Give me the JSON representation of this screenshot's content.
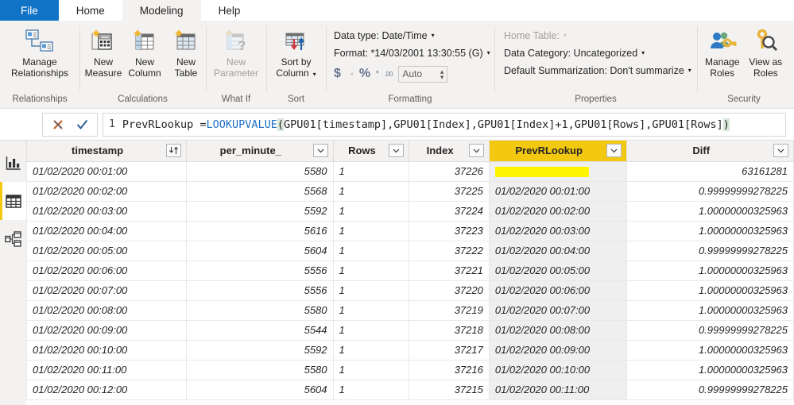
{
  "tabs": [
    {
      "label": "File",
      "state": "file"
    },
    {
      "label": "Home",
      "state": "normal"
    },
    {
      "label": "Modeling",
      "state": "active"
    },
    {
      "label": "Help",
      "state": "normal"
    }
  ],
  "ribbon": {
    "groups": {
      "relationships": {
        "label": "Relationships",
        "buttons": [
          {
            "label": "Manage\nRelationships",
            "icon": "manage-relationships-icon"
          }
        ]
      },
      "calculations": {
        "label": "Calculations",
        "buttons": [
          {
            "label": "New\nMeasure",
            "icon": "new-measure-icon"
          },
          {
            "label": "New\nColumn",
            "icon": "new-column-icon"
          },
          {
            "label": "New\nTable",
            "icon": "new-table-icon"
          }
        ]
      },
      "whatif": {
        "label": "What If",
        "buttons": [
          {
            "label": "New\nParameter",
            "icon": "new-parameter-icon",
            "disabled": true
          }
        ]
      },
      "sort": {
        "label": "Sort",
        "buttons": [
          {
            "label": "Sort by\nColumn",
            "icon": "sort-by-column-icon",
            "caret": true
          }
        ]
      },
      "formatting": {
        "label": "Formatting",
        "data_type": "Data type: Date/Time",
        "format": "Format: *14/03/2001 13:30:55 (G)",
        "currency_symbol": "$",
        "percent_symbol": "%",
        "comma_symbol": "'",
        "decimal_symbol": ".00",
        "decimal_places_value": "Auto"
      },
      "properties": {
        "label": "Properties",
        "home_table": "Home Table:",
        "data_category": "Data Category: Uncategorized",
        "default_summarization": "Default Summarization: Don't summarize"
      },
      "security": {
        "label": "Security",
        "buttons": [
          {
            "label": "Manage\nRoles",
            "icon": "manage-roles-icon"
          },
          {
            "label": "View as\nRoles",
            "icon": "view-as-roles-icon"
          }
        ]
      }
    }
  },
  "formula_bar": {
    "line_number": "1",
    "cancel_icon": "cancel-x-icon",
    "accept_icon": "accept-check-icon",
    "prefix": "PrevRLookup = ",
    "function_name": "LOOKUPVALUE",
    "open_paren": "(",
    "args": "GPU01[timestamp],GPU01[Index],GPU01[Index]+1,GPU01[Rows],GPU01[Rows]",
    "close_paren": ")",
    "full_formula": "PrevRLookup = LOOKUPVALUE(GPU01[timestamp],GPU01[Index],GPU01[Index]+1,GPU01[Rows],GPU01[Rows])"
  },
  "sidebar": {
    "items": [
      {
        "name": "report-view",
        "icon": "bar-chart-icon",
        "selected": false
      },
      {
        "name": "data-view",
        "icon": "table-grid-icon",
        "selected": true
      },
      {
        "name": "model-view",
        "icon": "model-relationships-icon",
        "selected": false
      }
    ]
  },
  "grid": {
    "columns": [
      {
        "label": "timestamp",
        "sorted": true,
        "highlighted": false,
        "align": "center"
      },
      {
        "label": "per_minute_",
        "sorted": false,
        "highlighted": false,
        "align": "center"
      },
      {
        "label": "Rows",
        "sorted": false,
        "highlighted": false,
        "align": "center"
      },
      {
        "label": "Index",
        "sorted": false,
        "highlighted": false,
        "align": "center"
      },
      {
        "label": "PrevRLookup",
        "sorted": false,
        "highlighted": true,
        "align": "center"
      },
      {
        "label": "Diff",
        "sorted": false,
        "highlighted": false,
        "align": "center"
      }
    ],
    "rows": [
      {
        "timestamp": "01/02/2020 00:01:00",
        "per_minute": "5580",
        "rows": "1",
        "index": "37226",
        "prevrlookup": "",
        "prevrlookup_highlight": true,
        "diff": "63161281"
      },
      {
        "timestamp": "01/02/2020 00:02:00",
        "per_minute": "5568",
        "rows": "1",
        "index": "37225",
        "prevrlookup": "01/02/2020 00:01:00",
        "prevrlookup_highlight": false,
        "diff": "0.99999999278225"
      },
      {
        "timestamp": "01/02/2020 00:03:00",
        "per_minute": "5592",
        "rows": "1",
        "index": "37224",
        "prevrlookup": "01/02/2020 00:02:00",
        "prevrlookup_highlight": false,
        "diff": "1.00000000325963"
      },
      {
        "timestamp": "01/02/2020 00:04:00",
        "per_minute": "5616",
        "rows": "1",
        "index": "37223",
        "prevrlookup": "01/02/2020 00:03:00",
        "prevrlookup_highlight": false,
        "diff": "1.00000000325963"
      },
      {
        "timestamp": "01/02/2020 00:05:00",
        "per_minute": "5604",
        "rows": "1",
        "index": "37222",
        "prevrlookup": "01/02/2020 00:04:00",
        "prevrlookup_highlight": false,
        "diff": "0.99999999278225"
      },
      {
        "timestamp": "01/02/2020 00:06:00",
        "per_minute": "5556",
        "rows": "1",
        "index": "37221",
        "prevrlookup": "01/02/2020 00:05:00",
        "prevrlookup_highlight": false,
        "diff": "1.00000000325963"
      },
      {
        "timestamp": "01/02/2020 00:07:00",
        "per_minute": "5556",
        "rows": "1",
        "index": "37220",
        "prevrlookup": "01/02/2020 00:06:00",
        "prevrlookup_highlight": false,
        "diff": "1.00000000325963"
      },
      {
        "timestamp": "01/02/2020 00:08:00",
        "per_minute": "5580",
        "rows": "1",
        "index": "37219",
        "prevrlookup": "01/02/2020 00:07:00",
        "prevrlookup_highlight": false,
        "diff": "1.00000000325963"
      },
      {
        "timestamp": "01/02/2020 00:09:00",
        "per_minute": "5544",
        "rows": "1",
        "index": "37218",
        "prevrlookup": "01/02/2020 00:08:00",
        "prevrlookup_highlight": false,
        "diff": "0.99999999278225"
      },
      {
        "timestamp": "01/02/2020 00:10:00",
        "per_minute": "5592",
        "rows": "1",
        "index": "37217",
        "prevrlookup": "01/02/2020 00:09:00",
        "prevrlookup_highlight": false,
        "diff": "1.00000000325963"
      },
      {
        "timestamp": "01/02/2020 00:11:00",
        "per_minute": "5580",
        "rows": "1",
        "index": "37216",
        "prevrlookup": "01/02/2020 00:10:00",
        "prevrlookup_highlight": false,
        "diff": "1.00000000325963"
      },
      {
        "timestamp": "01/02/2020 00:12:00",
        "per_minute": "5604",
        "rows": "1",
        "index": "37215",
        "prevrlookup": "01/02/2020 00:11:00",
        "prevrlookup_highlight": false,
        "diff": "0.99999999278225"
      }
    ]
  },
  "colors": {
    "file_tab_blue": "#1073c6",
    "highlight_gold": "#f2c811",
    "marker_yellow": "#fdf500",
    "ribbon_bg": "#f3f2f1",
    "selected_column_bg": "#efefef"
  }
}
